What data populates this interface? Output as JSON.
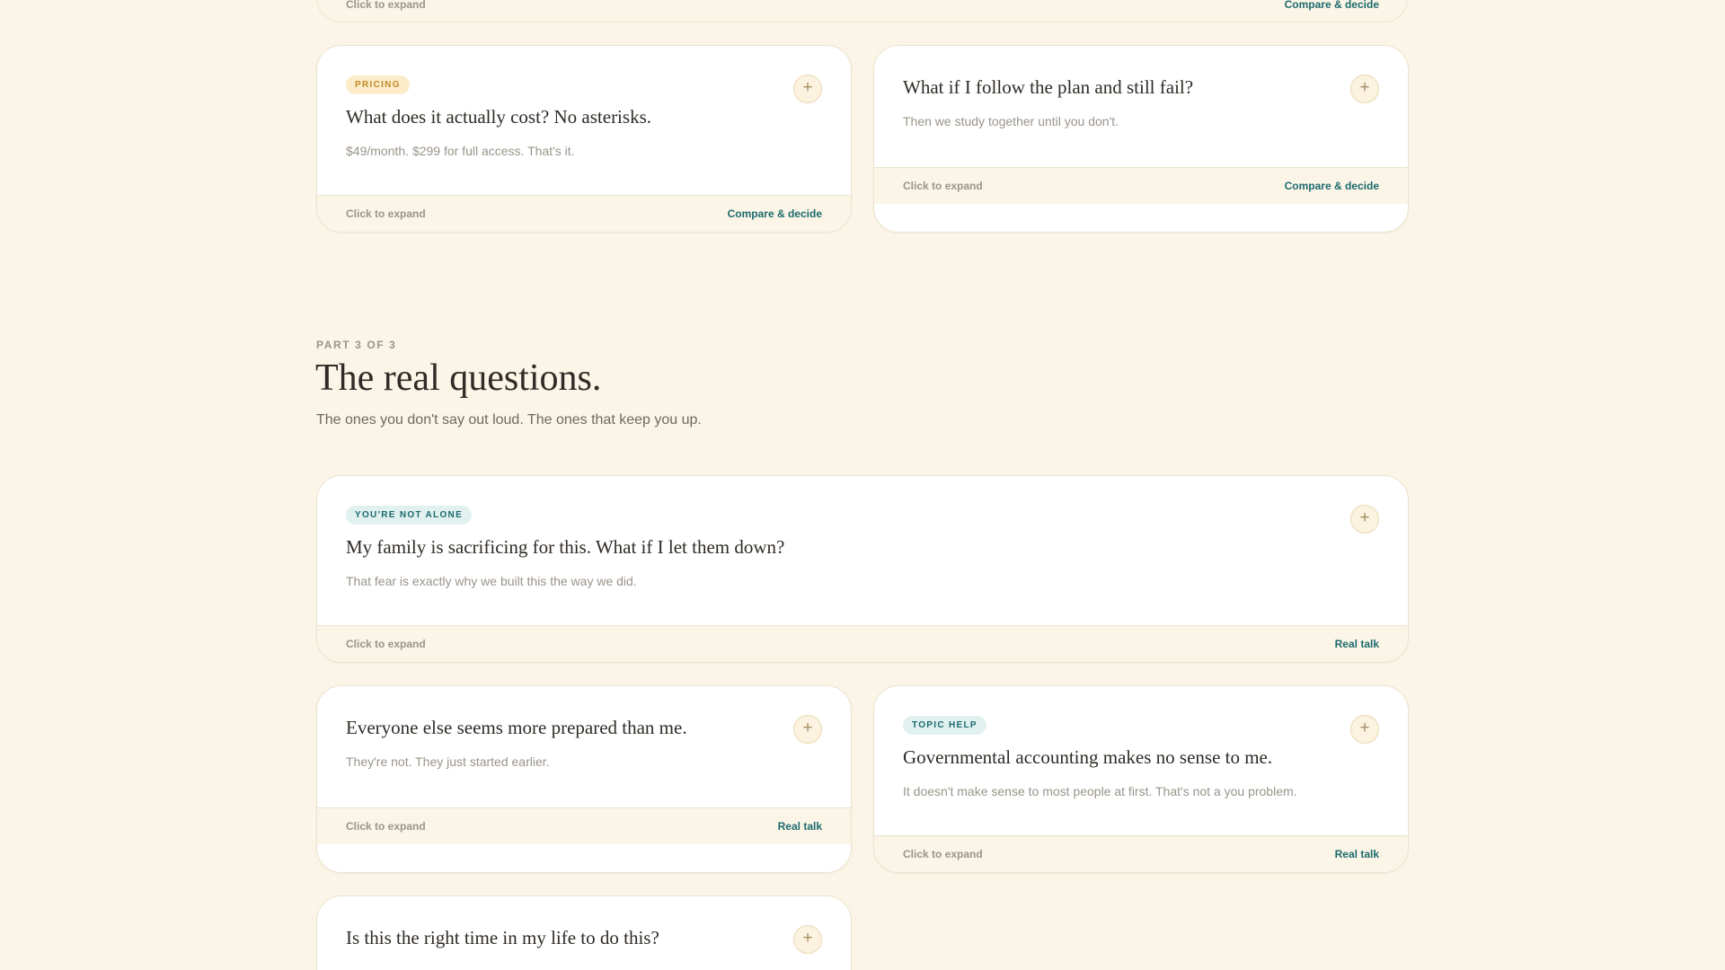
{
  "top_card": {
    "expand_hint": "Click to expand",
    "action": "Compare & decide"
  },
  "pricing_cards": [
    {
      "tag": "PRICING",
      "title": "What does it actually cost? No asterisks.",
      "subtitle": "$49/month. $299 for full access. That's it.",
      "expand_hint": "Click to expand",
      "action": "Compare & decide",
      "toggle": "+"
    },
    {
      "title": "What if I follow the plan and still fail?",
      "subtitle": "Then we study together until you don't.",
      "expand_hint": "Click to expand",
      "action": "Compare & decide",
      "toggle": "+"
    }
  ],
  "section": {
    "eyebrow": "PART 3 OF 3",
    "title": "The real questions.",
    "subtitle": "The ones you don't say out loud. The ones that keep you up."
  },
  "real_cards": [
    {
      "tag": "YOU'RE NOT ALONE",
      "title": "My family is sacrificing for this. What if I let them down?",
      "subtitle": "That fear is exactly why we built this the way we did.",
      "expand_hint": "Click to expand",
      "action": "Real talk",
      "toggle": "+"
    },
    {
      "title": "Everyone else seems more prepared than me.",
      "subtitle": "They're not. They just started earlier.",
      "expand_hint": "Click to expand",
      "action": "Real talk",
      "toggle": "+"
    },
    {
      "tag": "TOPIC HELP",
      "title": "Governmental accounting makes no sense to me.",
      "subtitle": "It doesn't make sense to most people at first. That's not a you problem.",
      "expand_hint": "Click to expand",
      "action": "Real talk",
      "toggle": "+"
    },
    {
      "title": "Is this the right time in my life to do this?",
      "toggle": "+"
    }
  ],
  "colors": {
    "background": "#fbf5e7",
    "accent_teal": "#1c6a6e",
    "tag_gold_bg": "#fcecc9",
    "tag_gold_text": "#c08a2a",
    "tag_teal_bg": "#e0f1ef"
  },
  "icons": {
    "expand_toggle": "plus-icon"
  }
}
